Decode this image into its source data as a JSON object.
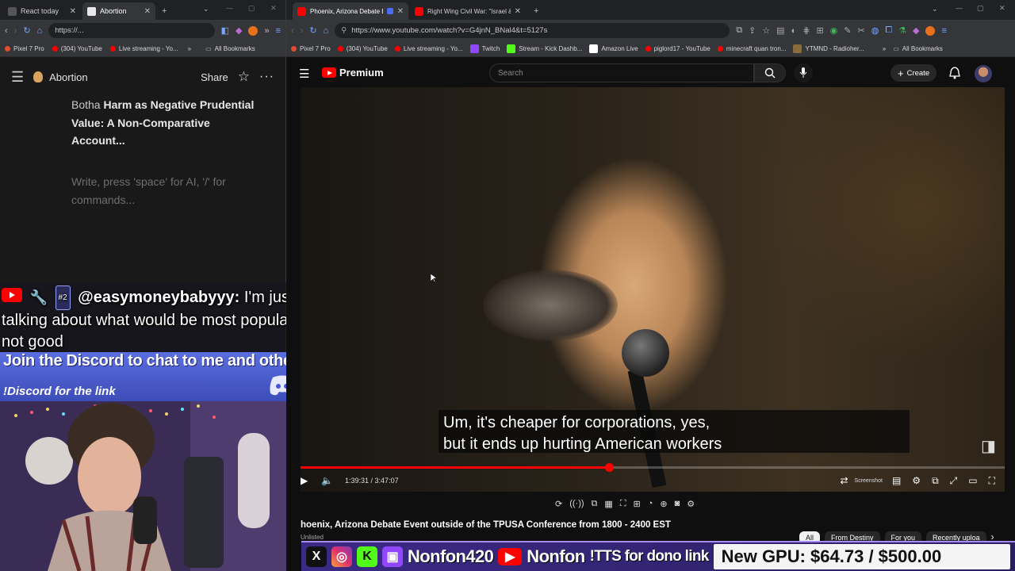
{
  "left_browser": {
    "tabs": [
      {
        "label": "React today",
        "favicon_color": "#555555"
      },
      {
        "label": "Abortion",
        "favicon_color": "#e8e8e8"
      }
    ],
    "url": "https://...",
    "bookmarks": [
      "Pixel 7 Pro",
      "(304) YouTube",
      "Live streaming - Yo...",
      "All Bookmarks"
    ]
  },
  "notion": {
    "page_title": "Abortion",
    "share_label": "Share",
    "text_prefix": "Botha ",
    "text_bold": "Harm as Negative Prudential Value: A Non-Comparative Account...",
    "placeholder": "Write, press 'space' for AI, '/' for commands..."
  },
  "chat": {
    "username": "@easymoneybabyyy:",
    "message": " I'm just talking about what would be most popular, not good",
    "badge": "#2"
  },
  "discord": {
    "title": "Join the Discord to chat to me and other fans!",
    "subtitle": "!Discord for the link"
  },
  "right_browser": {
    "tabs": [
      {
        "label": "Phoenix, Arizona Debate E",
        "favicon_color": "#ff0000"
      },
      {
        "label": "Right Wing Civil War: \"Israel &",
        "favicon_color": "#ff0000"
      }
    ],
    "url": "https://www.youtube.com/watch?v=G4jnN_BNal4&t=5127s",
    "bookmarks": [
      "Pixel 7 Pro",
      "(304) YouTube",
      "Live streaming - Yo...",
      "Twitch",
      "Stream - Kick Dashb...",
      "Amazon Live",
      "piglord17 - YouTube",
      "minecraft quan tron...",
      "YTMND - Radioher...",
      "All Bookmarks"
    ]
  },
  "youtube": {
    "logo_text": "Premium",
    "search_placeholder": "Search",
    "create_label": "Create",
    "caption_line1": "Um, it's cheaper for corporations, yes,",
    "caption_line2": "but it ends up hurting American workers",
    "time_current": "1:39:31",
    "time_total": "3:47:07",
    "progress_fraction": 0.4379,
    "screenshot_label": "Screenshot",
    "video_title": "hoenix, Arizona Debate Event outside of the TPUSA Conference from 1800 - 2400 EST",
    "visibility": "Unlisted",
    "chips": [
      "All",
      "From Destiny",
      "For you",
      "Recently uploa"
    ]
  },
  "overlay_bar": {
    "handle1": "Nonfon420",
    "handle2": "Nonfon",
    "tts": "!TTS for dono link",
    "gpu_goal": "New GPU: $64.73 / $500.00"
  },
  "colors": {
    "youtube_red": "#ff0000",
    "twitch_purple": "#9146ff",
    "kick_green": "#53fc18",
    "discord_blue": "#5865f2"
  }
}
